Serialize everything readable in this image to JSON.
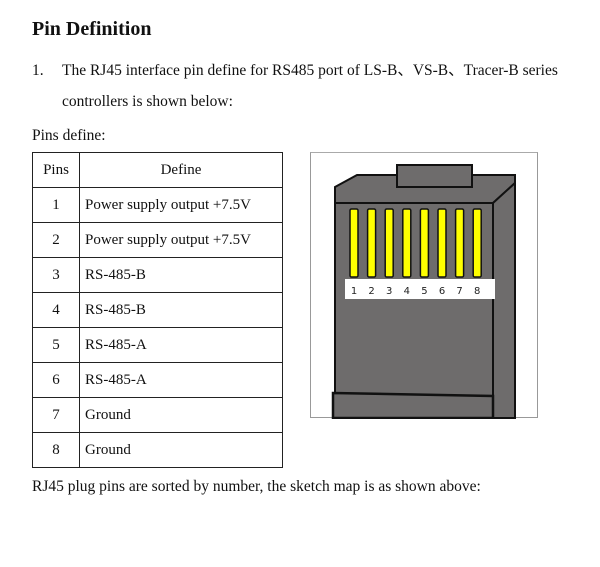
{
  "heading": "Pin Definition",
  "intro": {
    "number": "1.",
    "line1": "The RJ45 interface pin define for RS485 port of LS-B、VS-B、Tracer-B series",
    "line2": "controllers is shown below:"
  },
  "pins_label": "Pins define:",
  "table": {
    "headers": [
      "Pins",
      "Define"
    ],
    "rows": [
      {
        "pin": "1",
        "define": "Power supply output +7.5V"
      },
      {
        "pin": "2",
        "define": "Power supply output +7.5V"
      },
      {
        "pin": "3",
        "define": "RS-485-B"
      },
      {
        "pin": "4",
        "define": "RS-485-B"
      },
      {
        "pin": "5",
        "define": "RS-485-A"
      },
      {
        "pin": "6",
        "define": "RS-485-A"
      },
      {
        "pin": "7",
        "define": "Ground"
      },
      {
        "pin": "8",
        "define": "Ground"
      }
    ]
  },
  "figure": {
    "description": "RJ45 plug sketch",
    "pin_numbers": [
      "1",
      "2",
      "3",
      "4",
      "5",
      "6",
      "7",
      "8"
    ],
    "colors": {
      "body": "#6e6c6c",
      "contacts": "#ffff00",
      "outline": "#111111",
      "label_strip": "#ffffff"
    }
  },
  "footer": "RJ45 plug pins are sorted by number, the sketch map is as shown above:"
}
